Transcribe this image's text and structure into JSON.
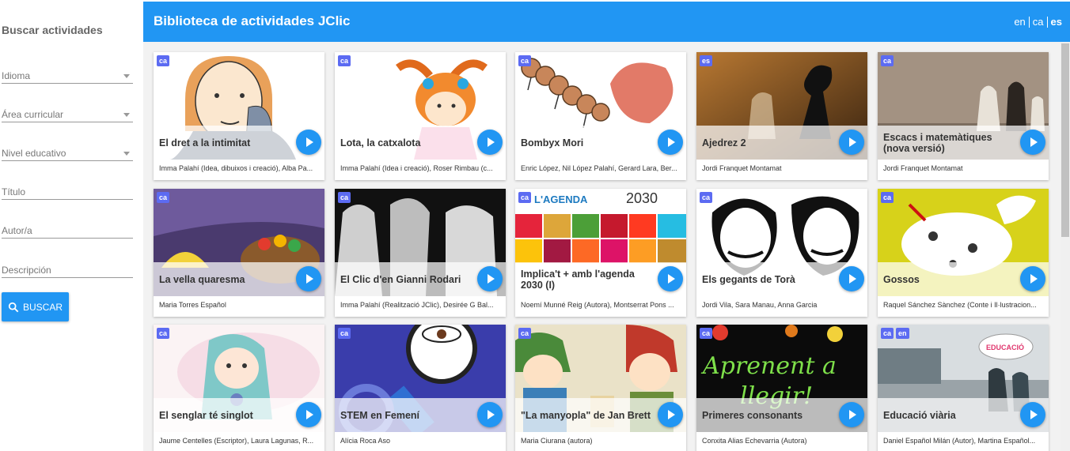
{
  "sidebar": {
    "heading": "Buscar actividades",
    "fields": {
      "idioma": "Idioma",
      "area": "Área curricular",
      "nivel": "Nivel educativo",
      "titulo": "Título",
      "autor": "Autor/a",
      "descripcion": "Descripción"
    },
    "search_button": "BUSCAR"
  },
  "header": {
    "title": "Biblioteca de actividades JClic",
    "langs": [
      "en",
      "ca",
      "es"
    ],
    "active_lang": "es"
  },
  "cards": [
    {
      "title": "El dret a la intimitat",
      "author": "Imma Palahí (Idea, dibuixos i creació), Alba Pa...",
      "langs": [
        "ca"
      ]
    },
    {
      "title": "Lota, la catxalota",
      "author": "Imma Palahí (Idea i creació), Roser Rimbau (c...",
      "langs": [
        "ca"
      ]
    },
    {
      "title": "Bombyx Mori",
      "author": "Enric López, Nil López Palahí, Gerard Lara, Ber...",
      "langs": [
        "ca"
      ]
    },
    {
      "title": "Ajedrez 2",
      "author": "Jordi Franquet Montamat",
      "langs": [
        "es"
      ]
    },
    {
      "title": "Escacs i matemàtiques (nova versió)",
      "author": "Jordi Franquet Montamat",
      "langs": [
        "ca"
      ]
    },
    {
      "title": "La vella quaresma",
      "author": "Maria Torres Español",
      "langs": [
        "ca"
      ]
    },
    {
      "title": "El Clic d'en Gianni Rodari",
      "author": "Imma Palahí (Realització JClic), Desirée G Bal...",
      "langs": [
        "ca"
      ]
    },
    {
      "title": "Implica't + amb l'agenda 2030 (I)",
      "author": "Noemí Munné Reig (Autora), Montserrat Pons ...",
      "langs": [
        "ca"
      ]
    },
    {
      "title": "Els gegants de Torà",
      "author": "Jordi Vila, Sara Manau, Anna Garcia",
      "langs": [
        "ca"
      ]
    },
    {
      "title": "Gossos",
      "author": "Raquel Sánchez Sànchez (Conte i Il·lustracion...",
      "langs": [
        "ca"
      ]
    },
    {
      "title": "El senglar té singlot",
      "author": "Jaume Centelles (Escriptor), Laura Lagunas, R...",
      "langs": [
        "ca"
      ]
    },
    {
      "title": "STEM en Femení",
      "author": "Alícia Roca Aso",
      "langs": [
        "ca"
      ]
    },
    {
      "title": "\"La manyopla\" de Jan Brett",
      "author": "Maria Ciurana (autora)",
      "langs": [
        "ca"
      ]
    },
    {
      "title": "Primeres consonants",
      "author": "Conxita Alias Echevarria (Autora)",
      "langs": [
        "ca"
      ]
    },
    {
      "title": "Educació viària",
      "author": "Daniel Español Milán (Autor), Martina Español...",
      "langs": [
        "ca",
        "en"
      ]
    }
  ],
  "image_texts": {
    "agenda": "L'AGENDA",
    "agenda_year": "2030",
    "aprenent_line1": "Aprenent a",
    "aprenent_line2": "llegir!",
    "educacio_bubble": "EDUCACIÓ"
  }
}
